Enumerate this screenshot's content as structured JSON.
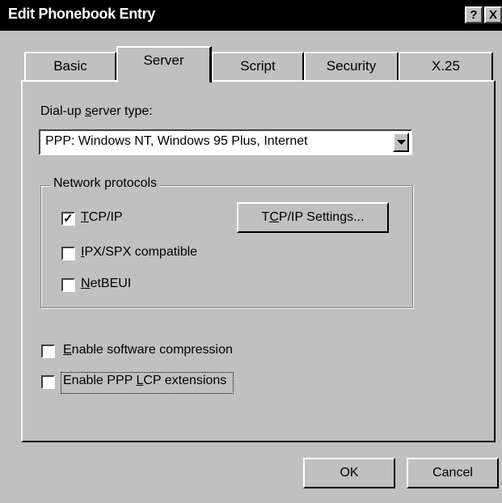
{
  "window": {
    "title": "Edit Phonebook Entry",
    "help_glyph": "?",
    "close_glyph": "X"
  },
  "tabs": [
    {
      "label": "Basic",
      "active": false
    },
    {
      "label": "Server",
      "active": true
    },
    {
      "label": "Script",
      "active": false
    },
    {
      "label": "Security",
      "active": false
    },
    {
      "label": "X.25",
      "active": false
    }
  ],
  "server_type": {
    "label_pre": "Dial-up ",
    "label_mnemonic": "s",
    "label_post": "erver type:",
    "value": "PPP: Windows NT, Windows 95 Plus, Internet"
  },
  "network_protocols": {
    "legend": "Network protocols",
    "tcpip": {
      "mnemonic": "T",
      "rest": "CP/IP",
      "checked": true
    },
    "ipx": {
      "mnemonic": "I",
      "rest": "PX/SPX compatible",
      "checked": false
    },
    "netbeui": {
      "mnemonic": "N",
      "rest": "etBEUI",
      "checked": false
    },
    "tcpip_settings_button": {
      "pre": "T",
      "mnemonic": "C",
      "post": "P/IP Settings..."
    }
  },
  "options": {
    "compression": {
      "mnemonic": "E",
      "rest": "nable software compression",
      "checked": false
    },
    "lcp": {
      "pre": "Enable PPP ",
      "mnemonic": "L",
      "post": "CP extensions",
      "checked": false
    }
  },
  "buttons": {
    "ok": "OK",
    "cancel": "Cancel"
  },
  "check_glyph": "✓"
}
